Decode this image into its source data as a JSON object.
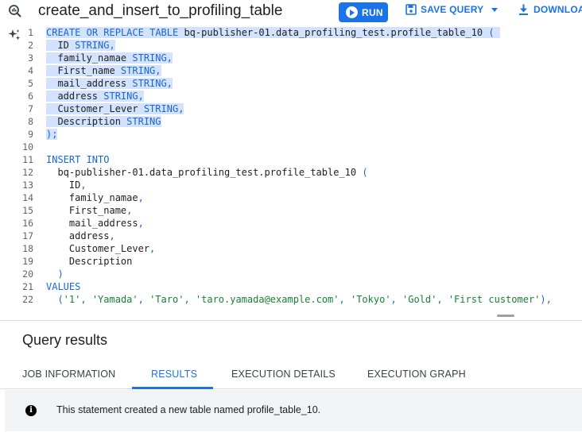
{
  "header": {
    "query_title": "create_and_insert_to_profiling_table",
    "run_label": "RUN",
    "save_label": "SAVE QUERY",
    "download_label": "DOWNLOA"
  },
  "editor": {
    "lines": [
      {
        "n": "1",
        "segs": [
          {
            "t": "CREATE",
            "c": "kw sel"
          },
          {
            "t": " ",
            "c": "sel"
          },
          {
            "t": "OR",
            "c": "kw sel"
          },
          {
            "t": " ",
            "c": "sel"
          },
          {
            "t": "REPLACE",
            "c": "kw sel"
          },
          {
            "t": " ",
            "c": "sel"
          },
          {
            "t": "TABLE",
            "c": "kw sel"
          },
          {
            "t": " bq-publisher-01.data_profiling_test.profile_table_10 ",
            "c": "id sel"
          },
          {
            "t": "(",
            "c": "kw sel"
          },
          {
            "t": " ",
            "c": "sel"
          }
        ]
      },
      {
        "n": "2",
        "segs": [
          {
            "t": "  ID ",
            "c": "id sel"
          },
          {
            "t": "STRING",
            "c": "kw sel"
          },
          {
            "t": ",",
            "c": "kw sel"
          }
        ]
      },
      {
        "n": "3",
        "segs": [
          {
            "t": "  family_namae ",
            "c": "id sel"
          },
          {
            "t": "STRING",
            "c": "kw sel"
          },
          {
            "t": ",",
            "c": "kw sel"
          }
        ]
      },
      {
        "n": "4",
        "segs": [
          {
            "t": "  First_name ",
            "c": "id sel"
          },
          {
            "t": "STRING",
            "c": "kw sel"
          },
          {
            "t": ",",
            "c": "kw sel"
          }
        ]
      },
      {
        "n": "5",
        "segs": [
          {
            "t": "  mail_address ",
            "c": "id sel"
          },
          {
            "t": "STRING",
            "c": "kw sel"
          },
          {
            "t": ",",
            "c": "kw sel"
          }
        ]
      },
      {
        "n": "6",
        "segs": [
          {
            "t": "  address ",
            "c": "id sel"
          },
          {
            "t": "STRING",
            "c": "kw sel"
          },
          {
            "t": ",",
            "c": "kw sel"
          }
        ]
      },
      {
        "n": "7",
        "segs": [
          {
            "t": "  Customer_Lever ",
            "c": "id sel"
          },
          {
            "t": "STRING",
            "c": "kw sel"
          },
          {
            "t": ",",
            "c": "kw sel"
          }
        ]
      },
      {
        "n": "8",
        "segs": [
          {
            "t": "  Description ",
            "c": "id sel"
          },
          {
            "t": "STRING",
            "c": "kw sel"
          }
        ]
      },
      {
        "n": "9",
        "segs": [
          {
            "t": ");",
            "c": "kw sel"
          }
        ]
      },
      {
        "n": "10",
        "segs": []
      },
      {
        "n": "11",
        "segs": [
          {
            "t": "INSERT INTO",
            "c": "kw"
          }
        ]
      },
      {
        "n": "12",
        "segs": [
          {
            "t": "  bq-publisher-01.data_profiling_test.profile_table_10 ",
            "c": "id"
          },
          {
            "t": "(",
            "c": "kw"
          }
        ]
      },
      {
        "n": "13",
        "segs": [
          {
            "t": "    ID",
            "c": "id"
          },
          {
            "t": ",",
            "c": "kw"
          }
        ]
      },
      {
        "n": "14",
        "segs": [
          {
            "t": "    family_namae",
            "c": "id"
          },
          {
            "t": ",",
            "c": "kw"
          }
        ]
      },
      {
        "n": "15",
        "segs": [
          {
            "t": "    First_name",
            "c": "id"
          },
          {
            "t": ",",
            "c": "kw"
          }
        ]
      },
      {
        "n": "16",
        "segs": [
          {
            "t": "    mail_address",
            "c": "id"
          },
          {
            "t": ",",
            "c": "kw"
          }
        ]
      },
      {
        "n": "17",
        "segs": [
          {
            "t": "    address",
            "c": "id"
          },
          {
            "t": ",",
            "c": "kw"
          }
        ]
      },
      {
        "n": "18",
        "segs": [
          {
            "t": "    Customer_Lever",
            "c": "id"
          },
          {
            "t": ",",
            "c": "kw"
          }
        ]
      },
      {
        "n": "19",
        "segs": [
          {
            "t": "    Description",
            "c": "id"
          }
        ]
      },
      {
        "n": "20",
        "segs": [
          {
            "t": "  )",
            "c": "kw"
          }
        ]
      },
      {
        "n": "21",
        "segs": [
          {
            "t": "VALUES",
            "c": "kw"
          }
        ]
      },
      {
        "n": "22",
        "segs": [
          {
            "t": "  (",
            "c": "kw"
          },
          {
            "t": "'1'",
            "c": "str"
          },
          {
            "t": ", ",
            "c": "kw"
          },
          {
            "t": "'Yamada'",
            "c": "str"
          },
          {
            "t": ", ",
            "c": "kw"
          },
          {
            "t": "'Taro'",
            "c": "str"
          },
          {
            "t": ", ",
            "c": "kw"
          },
          {
            "t": "'taro.yamada@example.com'",
            "c": "str"
          },
          {
            "t": ", ",
            "c": "kw"
          },
          {
            "t": "'Tokyo'",
            "c": "str"
          },
          {
            "t": ", ",
            "c": "kw"
          },
          {
            "t": "'Gold'",
            "c": "str"
          },
          {
            "t": ", ",
            "c": "kw"
          },
          {
            "t": "'First customer'",
            "c": "str"
          },
          {
            "t": "),",
            "c": "kw"
          }
        ]
      }
    ]
  },
  "results": {
    "title": "Query results",
    "tabs": [
      {
        "label": "JOB INFORMATION",
        "active": false
      },
      {
        "label": "RESULTS",
        "active": true
      },
      {
        "label": "EXECUTION DETAILS",
        "active": false
      },
      {
        "label": "EXECUTION GRAPH",
        "active": false
      }
    ],
    "message": "This statement created a new table named profile_table_10."
  },
  "colors": {
    "accent": "#1a73e8",
    "keyword": "#1967d2",
    "string": "#188038",
    "selection": "#d3e3fd"
  },
  "icons": {
    "query": "search-query-icon",
    "run": "play-icon",
    "save": "save-icon",
    "download": "download-icon",
    "assist": "sparkle-icon",
    "info": "info-icon"
  }
}
